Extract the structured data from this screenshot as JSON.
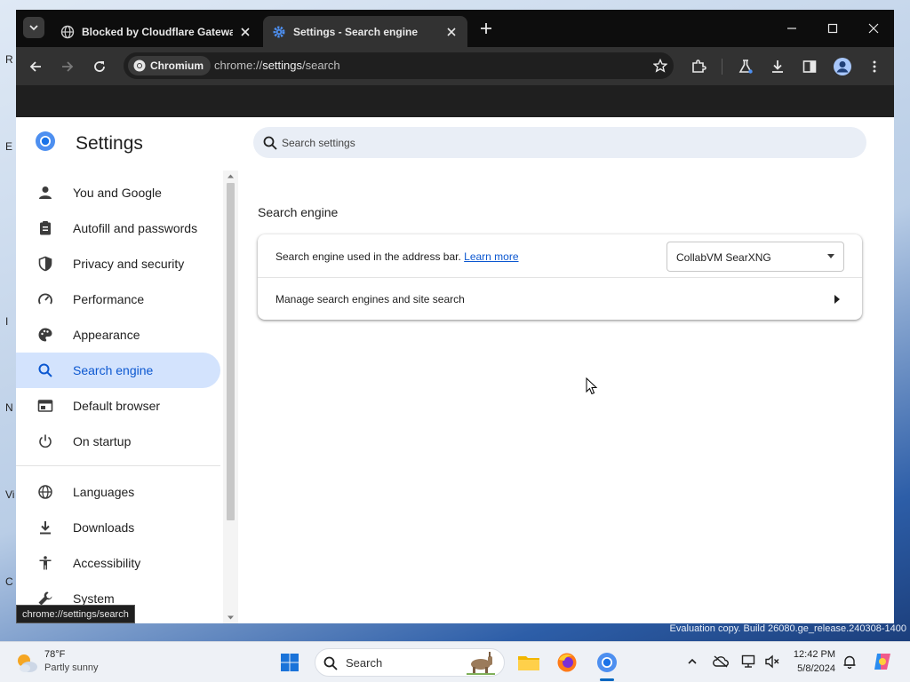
{
  "browser": {
    "tabs": [
      {
        "title": "Blocked by Cloudflare Gateway",
        "icon": "globe-icon"
      },
      {
        "title": "Settings - Search engine",
        "icon": "settings-gear-icon"
      }
    ],
    "site_chip": "Chromium",
    "url": {
      "prefix": "chrome://",
      "host": "settings",
      "path": "/search"
    },
    "status_tooltip": "chrome://settings/search"
  },
  "settings": {
    "title": "Settings",
    "search_placeholder": "Search settings",
    "nav": [
      {
        "label": "You and Google",
        "icon": "person-icon"
      },
      {
        "label": "Autofill and passwords",
        "icon": "clipboard-icon"
      },
      {
        "label": "Privacy and security",
        "icon": "shield-icon"
      },
      {
        "label": "Performance",
        "icon": "speedometer-icon"
      },
      {
        "label": "Appearance",
        "icon": "palette-icon"
      },
      {
        "label": "Search engine",
        "icon": "search-icon",
        "active": true
      },
      {
        "label": "Default browser",
        "icon": "browser-window-icon"
      },
      {
        "label": "On startup",
        "icon": "power-icon"
      },
      {
        "label": "Languages",
        "icon": "globe-icon"
      },
      {
        "label": "Downloads",
        "icon": "download-icon"
      },
      {
        "label": "Accessibility",
        "icon": "accessibility-icon"
      },
      {
        "label": "System",
        "icon": "wrench-icon"
      }
    ],
    "section_title": "Search engine",
    "row1_text": "Search engine used in the address bar.",
    "row1_link": "Learn more",
    "selected_engine": "CollabVM SearXNG",
    "row2_text": "Manage search engines and site search"
  },
  "desktop": {
    "watermark": "Evaluation copy. Build 26080.ge_release.240308-1400",
    "side_letters": [
      "R",
      "E",
      "I",
      "N",
      "Vi",
      "C"
    ]
  },
  "taskbar": {
    "weather_temp": "78°F",
    "weather_condition": "Partly sunny",
    "search_label": "Search",
    "time": "12:42 PM",
    "date": "5/8/2024"
  },
  "colors": {
    "accent": "#0b57d0",
    "nav_active_bg": "#d3e3fd",
    "tab_strip": "#0d0d0d",
    "toolbar": "#323232"
  }
}
